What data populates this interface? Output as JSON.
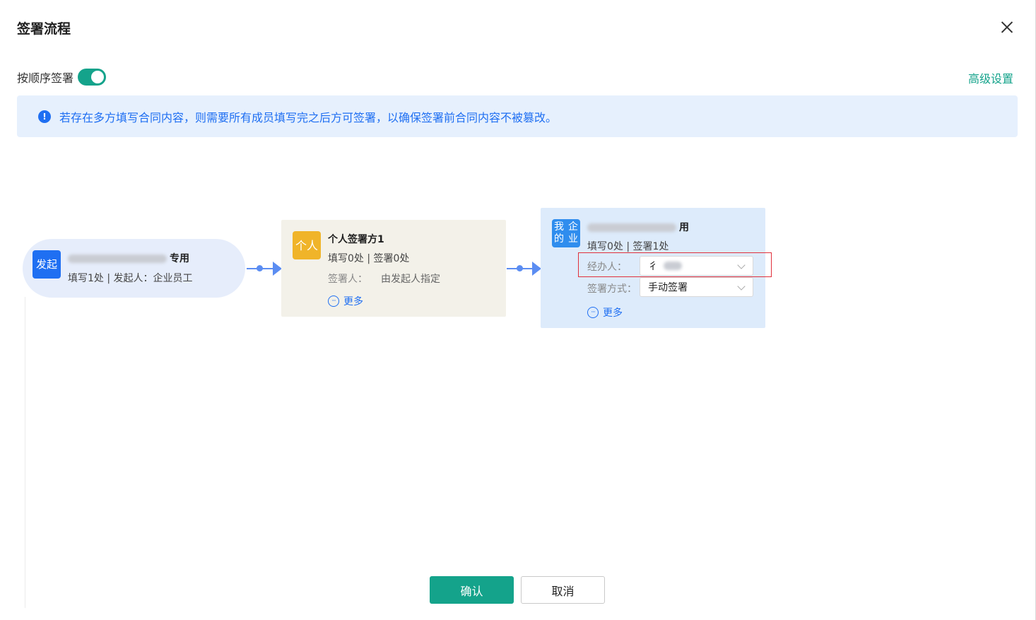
{
  "dialog": {
    "title": "签署流程",
    "order_label": "按顺序签署",
    "order_enabled": true,
    "advanced_link": "高级设置",
    "notice": "若存在多方填写合同内容，则需要所有成员填写完之后方可签署，以确保签署前合同内容不被篡改。",
    "notice_icon": "!"
  },
  "flow": {
    "start": {
      "badge": "发起",
      "name_suffix": "专用",
      "sub": "填写1处 | 发起人：企业员工"
    },
    "person": {
      "badge": "个人",
      "name": "个人签署方1",
      "sub": "填写0处 | 签署0处",
      "signer_label": "签署人：",
      "signer_value": "由发起人指定",
      "more": "更多"
    },
    "company": {
      "badge_line1": "我的",
      "badge_line2": "企业",
      "name_suffix": "用",
      "sub": "填写0处 | 签署1处",
      "handler_label": "经办人：",
      "handler_value": "彳",
      "sign_method_label": "签署方式：",
      "sign_method_value": "手动签署",
      "more": "更多"
    }
  },
  "footer": {
    "confirm": "确认",
    "cancel": "取消"
  },
  "colors": {
    "accent": "#14a38b",
    "info": "#1f6ff2",
    "highlight": "#e0303b"
  }
}
